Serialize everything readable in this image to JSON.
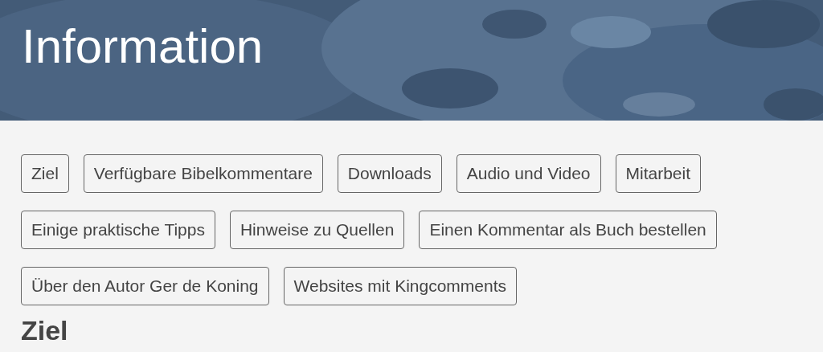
{
  "header": {
    "title": "Information"
  },
  "links": [
    {
      "label": "Ziel"
    },
    {
      "label": "Verfügbare Bibelkommentare"
    },
    {
      "label": "Downloads"
    },
    {
      "label": "Audio und Video"
    },
    {
      "label": "Mitarbeit"
    },
    {
      "label": "Einige praktische Tipps"
    },
    {
      "label": "Hinweise zu Quellen"
    },
    {
      "label": "Einen Kommentar als Buch bestellen"
    },
    {
      "label": "Über den Autor Ger de Koning"
    },
    {
      "label": "Websites mit Kingcomments"
    }
  ],
  "section_heading": "Ziel"
}
